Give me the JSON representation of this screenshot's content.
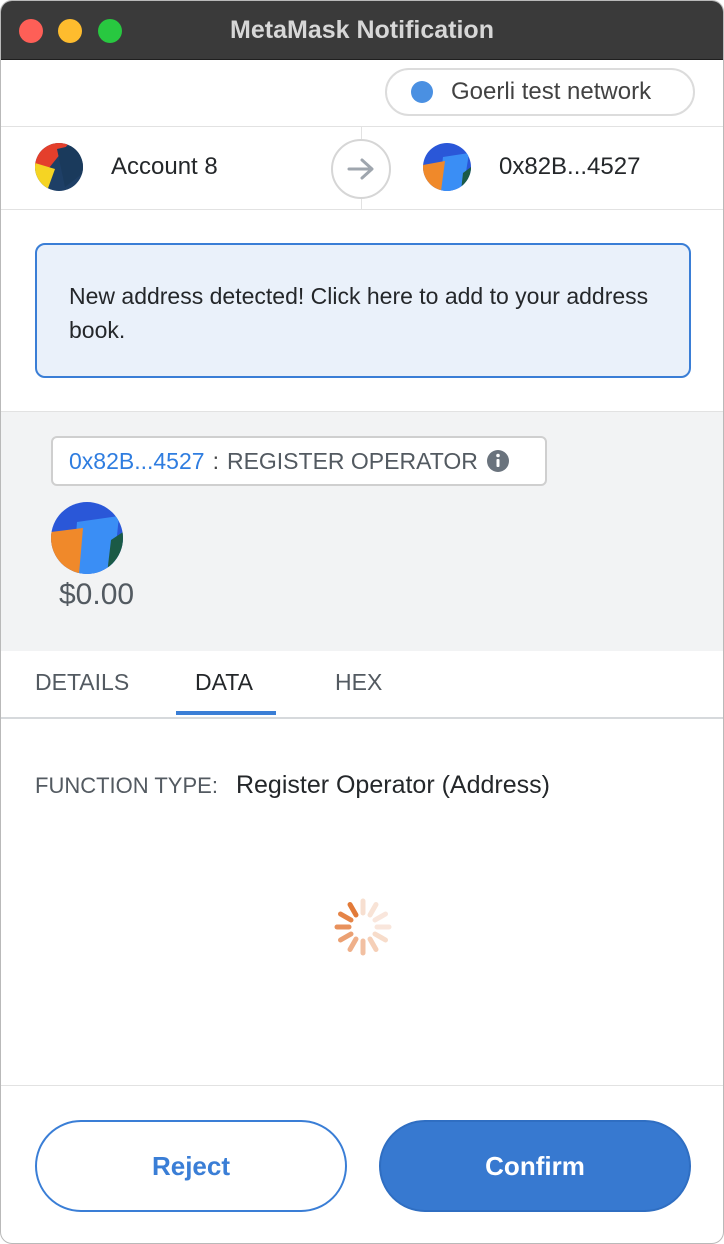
{
  "window": {
    "title": "MetaMask Notification"
  },
  "network": {
    "label": "Goerli test network",
    "dot_color": "#4a90e2"
  },
  "from_account": {
    "name": "Account 8"
  },
  "to_account": {
    "address": "0x82B...4527"
  },
  "notice": {
    "text": "New address detected! Click here to add to your address book."
  },
  "transaction": {
    "contract_address": "0x82B...4527",
    "separator": ":",
    "method": "REGISTER OPERATOR",
    "amount": "$0.00"
  },
  "tabs": [
    {
      "label": "DETAILS",
      "active": false
    },
    {
      "label": "DATA",
      "active": true
    },
    {
      "label": "HEX",
      "active": false
    }
  ],
  "data_panel": {
    "function_type_label": "FUNCTION TYPE:",
    "function_type_value": "Register Operator (Address)"
  },
  "actions": {
    "reject_label": "Reject",
    "confirm_label": "Confirm"
  },
  "colors": {
    "accent": "#3779d0",
    "link": "#2f7de0",
    "banner_bg": "#eaf1fa"
  }
}
